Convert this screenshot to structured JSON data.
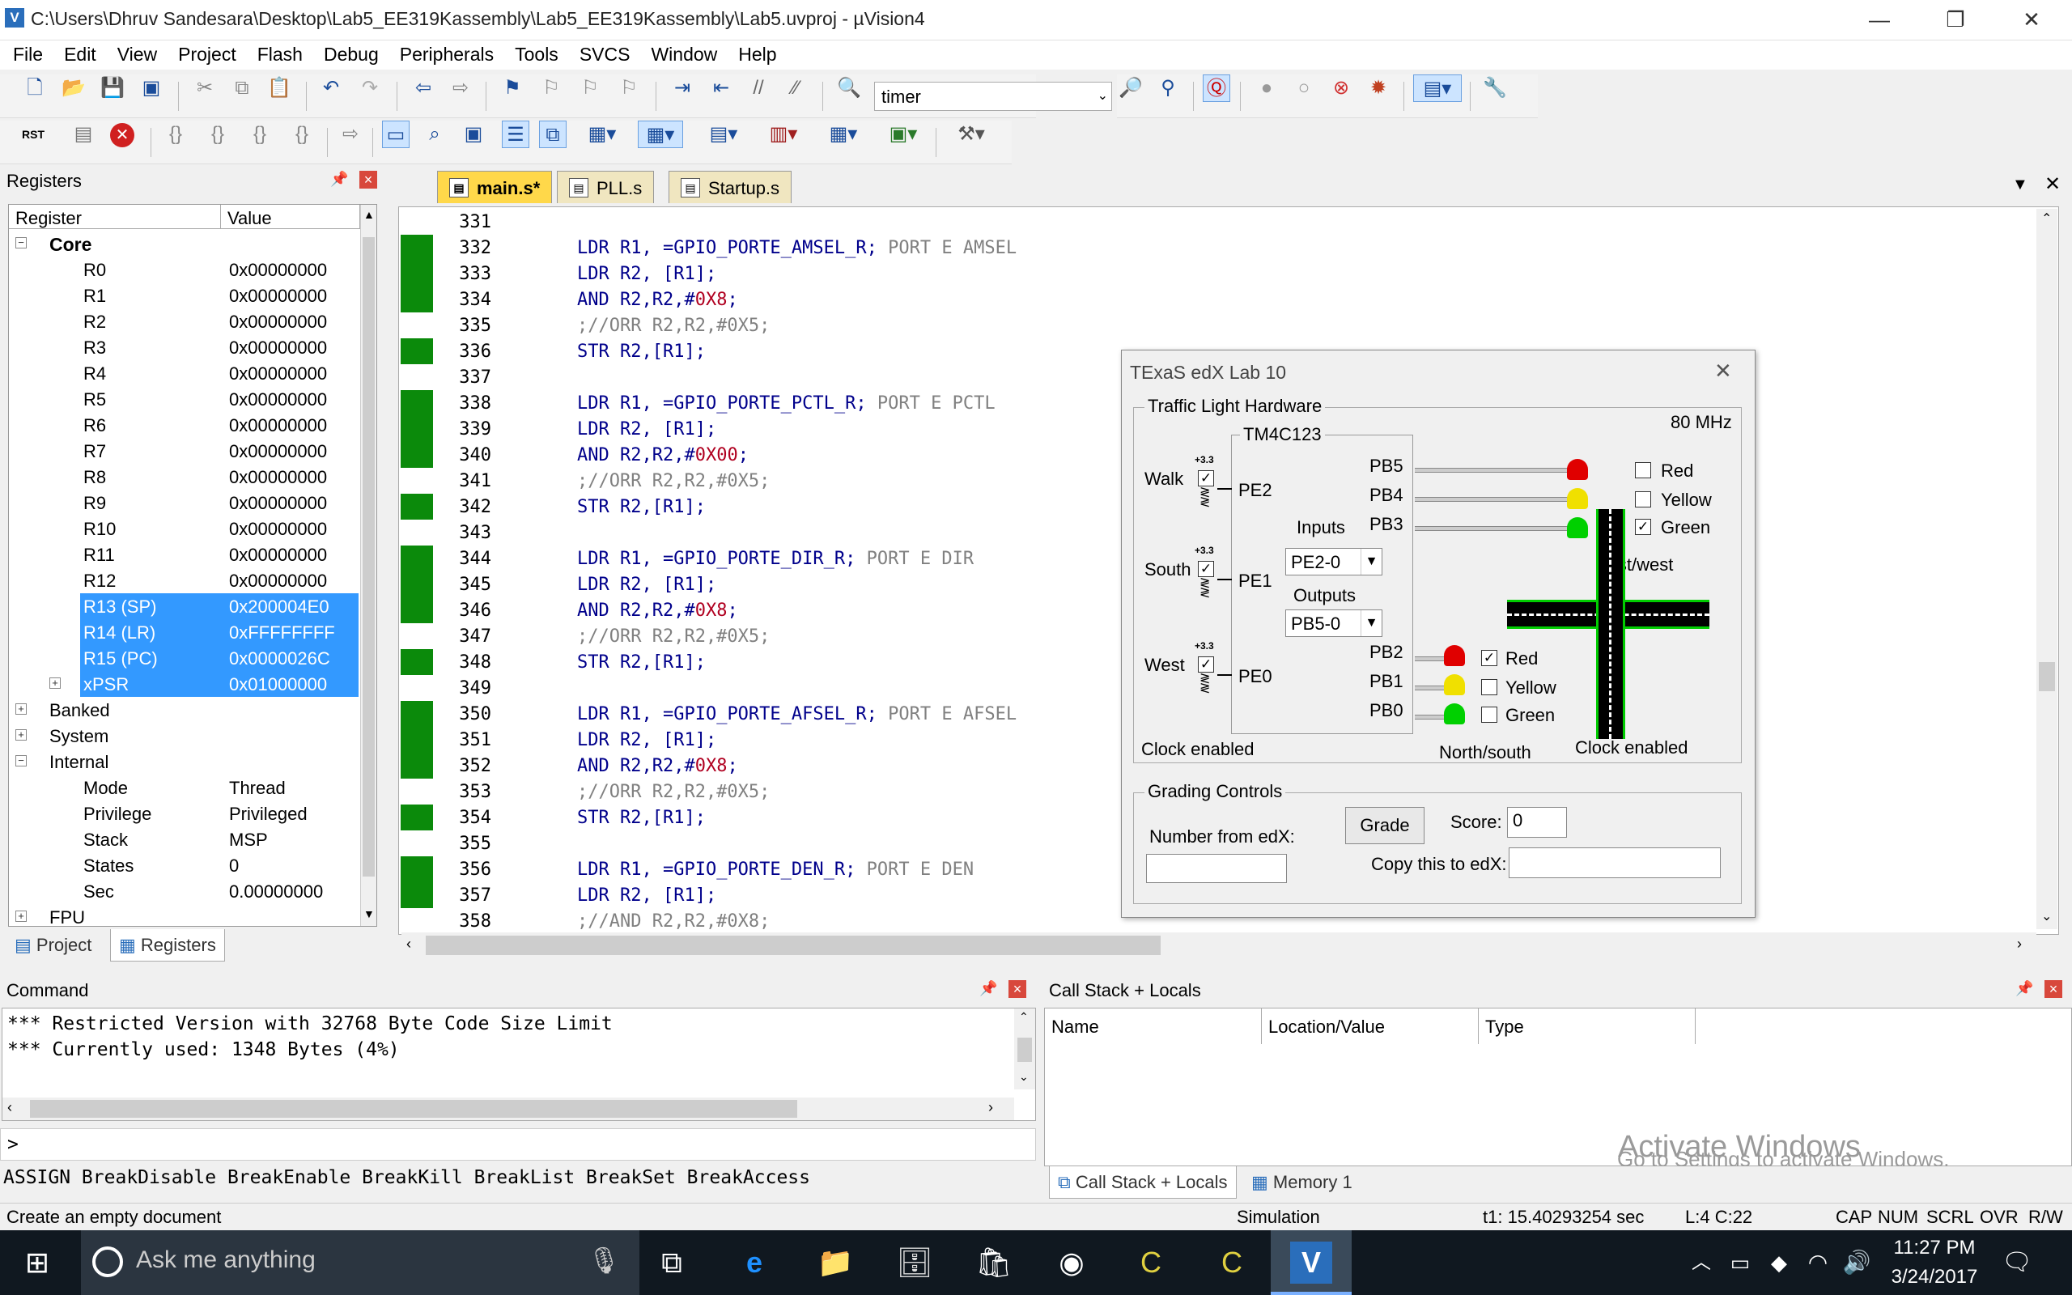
{
  "window": {
    "title": "C:\\Users\\Dhruv Sandesara\\Desktop\\Lab5_EE319Kassembly\\Lab5_EE319Kassembly\\Lab5.uvproj - µVision4",
    "minimize": "—",
    "restore": "❐",
    "close": "✕"
  },
  "menu": [
    "File",
    "Edit",
    "View",
    "Project",
    "Flash",
    "Debug",
    "Peripherals",
    "Tools",
    "SVCS",
    "Window",
    "Help"
  ],
  "toolbar": {
    "find_text": "timer"
  },
  "registers": {
    "title": "Registers",
    "col_register": "Register",
    "col_value": "Value",
    "core_label": "Core",
    "rows": [
      {
        "name": "R0",
        "value": "0x00000000"
      },
      {
        "name": "R1",
        "value": "0x00000000"
      },
      {
        "name": "R2",
        "value": "0x00000000"
      },
      {
        "name": "R3",
        "value": "0x00000000"
      },
      {
        "name": "R4",
        "value": "0x00000000"
      },
      {
        "name": "R5",
        "value": "0x00000000"
      },
      {
        "name": "R6",
        "value": "0x00000000"
      },
      {
        "name": "R7",
        "value": "0x00000000"
      },
      {
        "name": "R8",
        "value": "0x00000000"
      },
      {
        "name": "R9",
        "value": "0x00000000"
      },
      {
        "name": "R10",
        "value": "0x00000000"
      },
      {
        "name": "R11",
        "value": "0x00000000"
      },
      {
        "name": "R12",
        "value": "0x00000000"
      },
      {
        "name": "R13 (SP)",
        "value": "0x200004E0"
      },
      {
        "name": "R14 (LR)",
        "value": "0xFFFFFFFF"
      },
      {
        "name": "R15 (PC)",
        "value": "0x0000026C"
      },
      {
        "name": "xPSR",
        "value": "0x01000000"
      }
    ],
    "groups": [
      "Banked",
      "System",
      "Internal"
    ],
    "internal": [
      {
        "name": "Mode",
        "value": "Thread"
      },
      {
        "name": "Privilege",
        "value": "Privileged"
      },
      {
        "name": "Stack",
        "value": "MSP"
      },
      {
        "name": "States",
        "value": "0"
      },
      {
        "name": "Sec",
        "value": "0.00000000"
      }
    ],
    "fpu_label": "FPU",
    "tab_project": "Project",
    "tab_registers": "Registers"
  },
  "editor": {
    "tabs": [
      "main.s*",
      "PLL.s",
      "Startup.s"
    ],
    "lines": [
      {
        "n": "331",
        "g": false,
        "kind": "blank"
      },
      {
        "n": "332",
        "g": true,
        "kind": "ldr",
        "op": "LDR R1, ",
        "arg": "=GPIO_PORTE_AMSEL_R;",
        "cm": " PORT E AMSEL"
      },
      {
        "n": "333",
        "g": true,
        "kind": "plain",
        "op": "LDR R2, [R1];"
      },
      {
        "n": "334",
        "g": true,
        "kind": "and",
        "op": "AND R2,R2,#",
        "num": "0X8",
        "tail": ";"
      },
      {
        "n": "335",
        "g": false,
        "kind": "comment",
        "cm": ";//ORR R2,R2,#0X5;"
      },
      {
        "n": "336",
        "g": true,
        "kind": "plain",
        "op": "STR R2,[R1];"
      },
      {
        "n": "337",
        "g": false,
        "kind": "blank"
      },
      {
        "n": "338",
        "g": true,
        "kind": "ldr",
        "op": "LDR R1, ",
        "arg": "=GPIO_PORTE_PCTL_R;",
        "cm": " PORT E PCTL"
      },
      {
        "n": "339",
        "g": true,
        "kind": "plain",
        "op": "LDR R2, [R1];"
      },
      {
        "n": "340",
        "g": true,
        "kind": "and",
        "op": "AND R2,R2,#",
        "num": "0X00",
        "tail": ";"
      },
      {
        "n": "341",
        "g": false,
        "kind": "comment",
        "cm": ";//ORR R2,R2,#0X5;"
      },
      {
        "n": "342",
        "g": true,
        "kind": "plain",
        "op": "STR R2,[R1];"
      },
      {
        "n": "343",
        "g": false,
        "kind": "blank"
      },
      {
        "n": "344",
        "g": true,
        "kind": "ldr",
        "op": "LDR R1, ",
        "arg": "=GPIO_PORTE_DIR_R;",
        "cm": " PORT E DIR"
      },
      {
        "n": "345",
        "g": true,
        "kind": "plain",
        "op": "LDR R2, [R1];"
      },
      {
        "n": "346",
        "g": true,
        "kind": "and",
        "op": "AND R2,R2,#",
        "num": "0X8",
        "tail": ";"
      },
      {
        "n": "347",
        "g": false,
        "kind": "comment",
        "cm": ";//ORR R2,R2,#0X5;"
      },
      {
        "n": "348",
        "g": true,
        "kind": "plain",
        "op": "STR R2,[R1];"
      },
      {
        "n": "349",
        "g": false,
        "kind": "blank"
      },
      {
        "n": "350",
        "g": true,
        "kind": "ldr",
        "op": "LDR R1, ",
        "arg": "=GPIO_PORTE_AFSEL_R;",
        "cm": " PORT E AFSEL"
      },
      {
        "n": "351",
        "g": true,
        "kind": "plain",
        "op": "LDR R2, [R1];"
      },
      {
        "n": "352",
        "g": true,
        "kind": "and",
        "op": "AND R2,R2,#",
        "num": "0X8",
        "tail": ";"
      },
      {
        "n": "353",
        "g": false,
        "kind": "comment",
        "cm": ";//ORR R2,R2,#0X5;"
      },
      {
        "n": "354",
        "g": true,
        "kind": "plain",
        "op": "STR R2,[R1];"
      },
      {
        "n": "355",
        "g": false,
        "kind": "blank"
      },
      {
        "n": "356",
        "g": true,
        "kind": "ldr",
        "op": "LDR R1, ",
        "arg": "=GPIO_PORTE_DEN_R;",
        "cm": " PORT E DEN"
      },
      {
        "n": "357",
        "g": true,
        "kind": "plain",
        "op": "LDR R2, [R1];"
      },
      {
        "n": "358",
        "g": false,
        "kind": "comment",
        "cm": ";//AND R2,R2,#0X8;"
      }
    ]
  },
  "texas": {
    "title": "TExaS edX Lab 10",
    "hw_group": "Traffic Light Hardware",
    "chip": "TM4C123",
    "freq": "80 MHz",
    "v33": "+3.3",
    "walk": "Walk",
    "south": "South",
    "west": "West",
    "pe2": "PE2",
    "pe1": "PE1",
    "pe0": "PE0",
    "inputs": "Inputs",
    "inputs_sel": "PE2-0",
    "outputs": "Outputs",
    "outputs_sel": "PB5-0",
    "pb5": "PB5",
    "pb4": "PB4",
    "pb3": "PB3",
    "pb2": "PB2",
    "pb1": "PB1",
    "pb0": "PB0",
    "ew_red": "Red",
    "ew_yellow": "Yellow",
    "ew_green": "Green",
    "ew_label": "East/west",
    "ns_red": "Red",
    "ns_yellow": "Yellow",
    "ns_green": "Green",
    "ns_label": "North/south",
    "clock_left": "Clock enabled",
    "clock_right": "Clock enabled",
    "grading_group": "Grading Controls",
    "number_label": "Number from edX:",
    "grade_btn": "Grade",
    "score_label": "Score:",
    "score_value": "0",
    "copy_label": "Copy this to edX:",
    "close": "✕",
    "colors": {
      "red": "#e00000",
      "yellow": "#f0e000",
      "green": "#00d000"
    }
  },
  "command": {
    "title": "Command",
    "lines": [
      "*** Restricted Version with 32768 Byte Code Size Limit",
      "*** Currently used: 1348 Bytes (4%)"
    ],
    "prompt": ">",
    "hint": "ASSIGN BreakDisable BreakEnable BreakKill BreakList BreakSet BreakAccess"
  },
  "callstack": {
    "title": "Call Stack + Locals",
    "col_name": "Name",
    "col_loc": "Location/Value",
    "col_type": "Type",
    "tab_callstack": "Call Stack + Locals",
    "tab_memory": "Memory 1",
    "watermark_1": "Activate Windows",
    "watermark_2": "Go to Settings to activate Windows."
  },
  "status": {
    "left": "Create an empty document",
    "mode": "Simulation",
    "time": "t1: 15.40293254 sec",
    "pos": "L:4 C:22",
    "cap": "CAP",
    "num": "NUM",
    "scrl": "SCRL",
    "ovr": "OVR",
    "rw": "R/W"
  },
  "taskbar": {
    "search_placeholder": "Ask me anything",
    "time": "11:27 PM",
    "date": "3/24/2017"
  }
}
